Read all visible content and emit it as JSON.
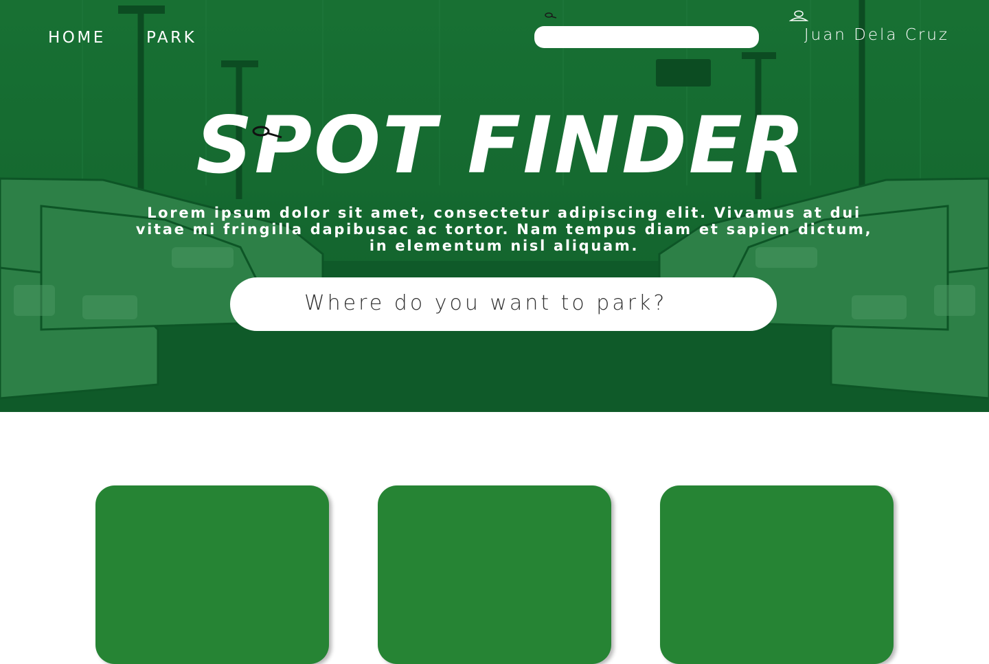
{
  "nav": {
    "home_label": "HOME",
    "park_label": "PARK"
  },
  "header": {
    "search_placeholder": "",
    "search_icon": "search-icon",
    "user_icon": "user-icon",
    "user_name": "Juan Dela Cruz"
  },
  "hero": {
    "title": "SPOT FINDER",
    "subtitle": "Lorem ipsum dolor sit amet, consectetur adipiscing elit. Vivamus at dui vitae mi fringilla dapibusac ac tortor. Nam tempus diam et sapien dictum, in elementum nisl aliquam.",
    "search_placeholder": "Where do you want to park?",
    "background": "parking-lot-photo"
  },
  "cards": [
    {
      "name": "card-1"
    },
    {
      "name": "card-2"
    },
    {
      "name": "card-3"
    }
  ],
  "colors": {
    "hero_green": "#1d6b34",
    "card_green": "#268434",
    "text_white": "#ffffff"
  }
}
